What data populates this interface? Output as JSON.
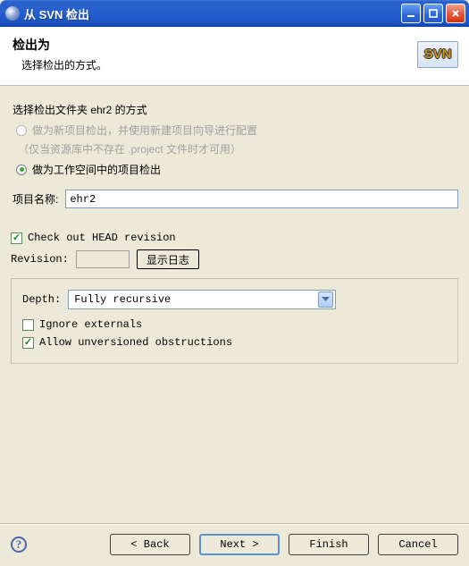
{
  "window": {
    "title": "从 SVN 检出"
  },
  "header": {
    "title": "检出为",
    "subtitle": "选择检出的方式。",
    "logo_text": "SVN"
  },
  "form": {
    "select_method_label": "选择检出文件夹 ehr2 的方式",
    "radio_new_project": "做为新项目检出，并使用新建项目向导进行配置",
    "hint_paren": "（仅当资源库中不存在 .project 文件时才可用）",
    "radio_workspace": "做为工作空间中的项目检出",
    "project_name_label": "项目名称:",
    "project_name_value": "ehr2",
    "check_head_label": "Check out HEAD revision",
    "check_head_checked": true,
    "revision_label": "Revision:",
    "revision_value": "",
    "show_log_btn": "显示日志",
    "depth_label": "Depth:",
    "depth_value": "Fully recursive",
    "ignore_externals_label": "Ignore externals",
    "ignore_externals_checked": false,
    "allow_unversioned_label": "Allow unversioned obstructions",
    "allow_unversioned_checked": true
  },
  "footer": {
    "back": "< Back",
    "next": "Next >",
    "finish": "Finish",
    "cancel": "Cancel"
  }
}
